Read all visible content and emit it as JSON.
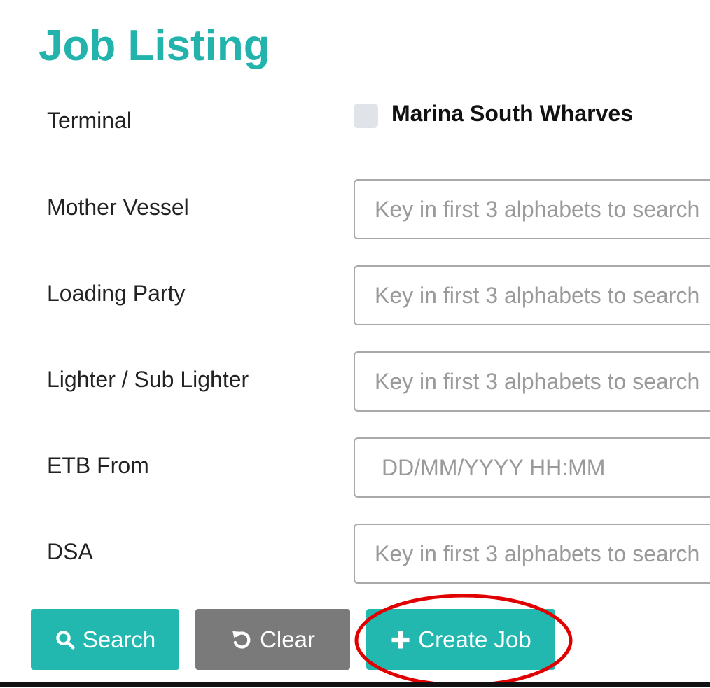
{
  "page": {
    "title": "Job Listing"
  },
  "terminal": {
    "label": "Terminal",
    "option_label": "Marina South Wharves",
    "checked": false
  },
  "fields": {
    "mother_vessel": {
      "label": "Mother Vessel",
      "placeholder": "Key in first 3 alphabets to search"
    },
    "loading_party": {
      "label": "Loading Party",
      "placeholder": "Key in first 3 alphabets to search"
    },
    "lighter": {
      "label": "Lighter / Sub Lighter",
      "placeholder": "Key in first 3 alphabets to search"
    },
    "etb_from": {
      "label": "ETB From",
      "placeholder": "DD/MM/YYYY HH:MM"
    },
    "dsa": {
      "label": "DSA",
      "placeholder": "Key in first 3 alphabets to search"
    }
  },
  "buttons": {
    "search_label": "Search",
    "search_icon": "search-icon",
    "clear_label": "Clear",
    "clear_icon": "undo-icon",
    "create_label": "Create Job",
    "create_icon": "plus-icon"
  },
  "colors": {
    "accent": "#22b3ad",
    "primary_button": "#22b8b0",
    "secondary_button": "#7a7a7a",
    "highlight": "#e00000"
  }
}
